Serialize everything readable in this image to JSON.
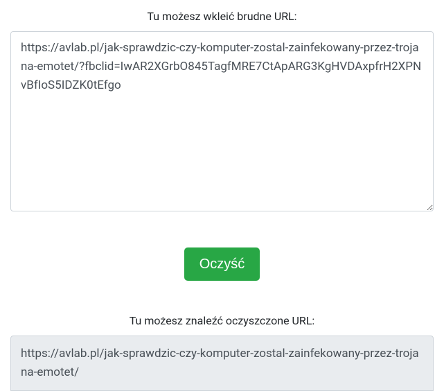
{
  "input": {
    "label": "Tu możesz wkleić brudne URL:",
    "value": "https://avlab.pl/jak-sprawdzic-czy-komputer-zostal-zainfekowany-przez-trojana-emotet/?fbclid=IwAR2XGrbO845TagfMRE7CtApARG3KgHVDAxpfrH2XPNvBfIoS5IDZK0tEfgo"
  },
  "action": {
    "clean_label": "Oczyść"
  },
  "output": {
    "label": "Tu możesz znaleźć oczyszczone URL:",
    "value": "https://avlab.pl/jak-sprawdzic-czy-komputer-zostal-zainfekowany-przez-trojana-emotet/"
  }
}
